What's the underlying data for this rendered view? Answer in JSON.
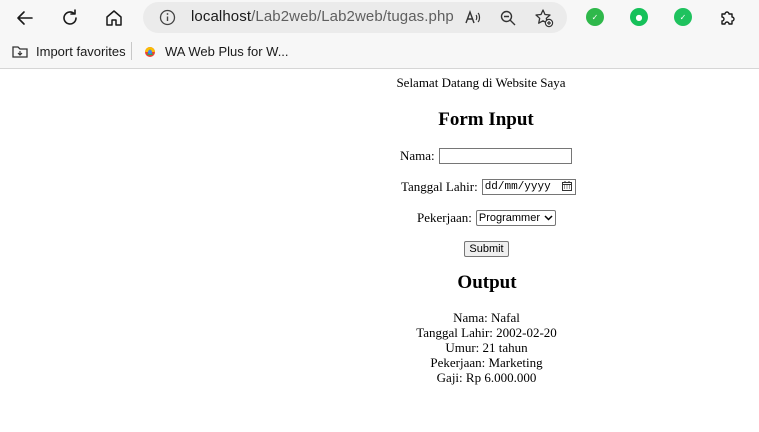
{
  "browser": {
    "url_host": "localhost",
    "url_path": "/Lab2web/Lab2web/tugas.php",
    "favorites": [
      {
        "label": "Import favorites"
      },
      {
        "label": "WA Web Plus for W..."
      }
    ],
    "extensions": [
      {
        "icon": "extension-chatgpt-icon",
        "color": "#2fb84b"
      },
      {
        "icon": "extension-green-bot-icon",
        "color": "#16c15a"
      },
      {
        "icon": "extension-green-chat-icon",
        "color": "#1fc25e"
      }
    ]
  },
  "page": {
    "welcome": "Selamat Datang di Website Saya",
    "form_title": "Form Input",
    "form": {
      "nama_label": "Nama:",
      "nama_value": "",
      "tanggal_label": "Tanggal Lahir:",
      "tanggal_placeholder": "dd/mm/yyyy",
      "pekerjaan_label": "Pekerjaan:",
      "pekerjaan_selected": "Programmer",
      "submit_label": "Submit"
    },
    "output_title": "Output",
    "output": {
      "nama": "Nama: Nafal",
      "tanggal": "Tanggal Lahir: 2002-02-20",
      "umur": "Umur: 21 tahun",
      "pekerjaan": "Pekerjaan: Marketing",
      "gaji": "Gaji: Rp 6.000.000"
    }
  }
}
